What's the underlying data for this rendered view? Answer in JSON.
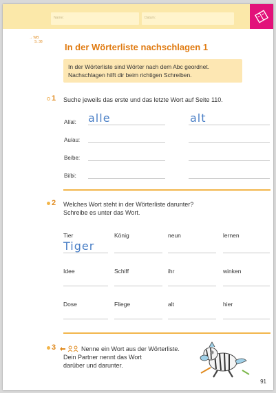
{
  "header": {
    "name_label": "Name:",
    "date_label": "Datum:"
  },
  "colors": {
    "accent": "#e07b12",
    "band": "#fbe8a9",
    "corner": "#e2127a",
    "handwriting": "#4a7fc6"
  },
  "icons": {
    "corner": "book-icon"
  },
  "reference": {
    "line1": "→ WB",
    "line2": "S. 38"
  },
  "title": "In der Wörterliste nachschlagen 1",
  "info": {
    "line1": "In der Wörterliste sind Wörter nach dem Abc geordnet.",
    "line2": "Nachschlagen hilft dir beim richtigen Schreiben."
  },
  "task1": {
    "number": "1",
    "text": "Suche jeweils das erste und das letzte Wort auf Seite 110.",
    "rows": [
      {
        "label": "Al/al:",
        "first": "alle",
        "last": "alt"
      },
      {
        "label": "Au/au:",
        "first": "",
        "last": ""
      },
      {
        "label": "Be/be:",
        "first": "",
        "last": ""
      },
      {
        "label": "Bi/bi:",
        "first": "",
        "last": ""
      }
    ]
  },
  "task2": {
    "number": "2",
    "line1": "Welches Wort steht in der Wörterliste darunter?",
    "line2": "Schreibe es unter das Wort.",
    "rows": [
      [
        {
          "word": "Tier",
          "answer": "Tiger"
        },
        {
          "word": "König",
          "answer": ""
        },
        {
          "word": "neun",
          "answer": ""
        },
        {
          "word": "lernen",
          "answer": ""
        }
      ],
      [
        {
          "word": "Idee",
          "answer": ""
        },
        {
          "word": "Schiff",
          "answer": ""
        },
        {
          "word": "ihr",
          "answer": ""
        },
        {
          "word": "winken",
          "answer": ""
        }
      ],
      [
        {
          "word": "Dose",
          "answer": ""
        },
        {
          "word": "Fliege",
          "answer": ""
        },
        {
          "word": "alt",
          "answer": ""
        },
        {
          "word": "hier",
          "answer": ""
        }
      ]
    ]
  },
  "task3": {
    "number": "3",
    "line1": "Nenne ein Wort aus der Wörterliste.",
    "line2": "Dein Partner nennt das Wort",
    "line3": "darüber und darunter."
  },
  "page_number": "91"
}
